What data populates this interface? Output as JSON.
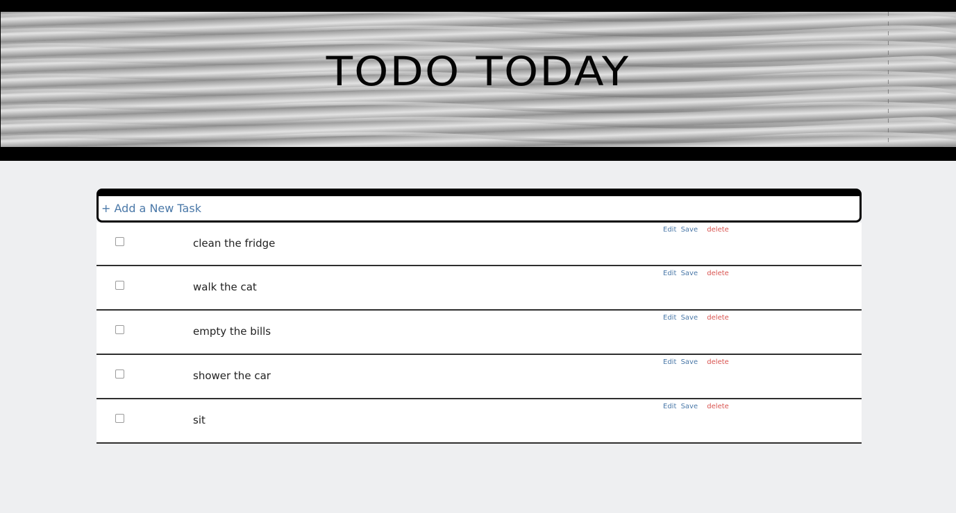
{
  "header": {
    "title": "TODO TODAY"
  },
  "add_task": {
    "label": "+ Add a New Task"
  },
  "tasks": [
    {
      "text": "clean the fridge",
      "checked": false,
      "edit_label": "Edit",
      "save_label": "Save",
      "delete_label": "delete"
    },
    {
      "text": "walk the cat",
      "checked": false,
      "edit_label": "Edit",
      "save_label": "Save",
      "delete_label": "delete"
    },
    {
      "text": "empty the bills",
      "checked": false,
      "edit_label": "Edit",
      "save_label": "Save",
      "delete_label": "delete"
    },
    {
      "text": "shower the car",
      "checked": false,
      "edit_label": "Edit",
      "save_label": "Save",
      "delete_label": "delete"
    },
    {
      "text": "sit",
      "checked": false,
      "edit_label": "Edit",
      "save_label": "Save",
      "delete_label": "delete"
    }
  ],
  "colors": {
    "link_blue": "#4a78a8",
    "delete_red": "#d9534f",
    "page_bg": "#eeeff1",
    "header_bg": "#000000"
  }
}
